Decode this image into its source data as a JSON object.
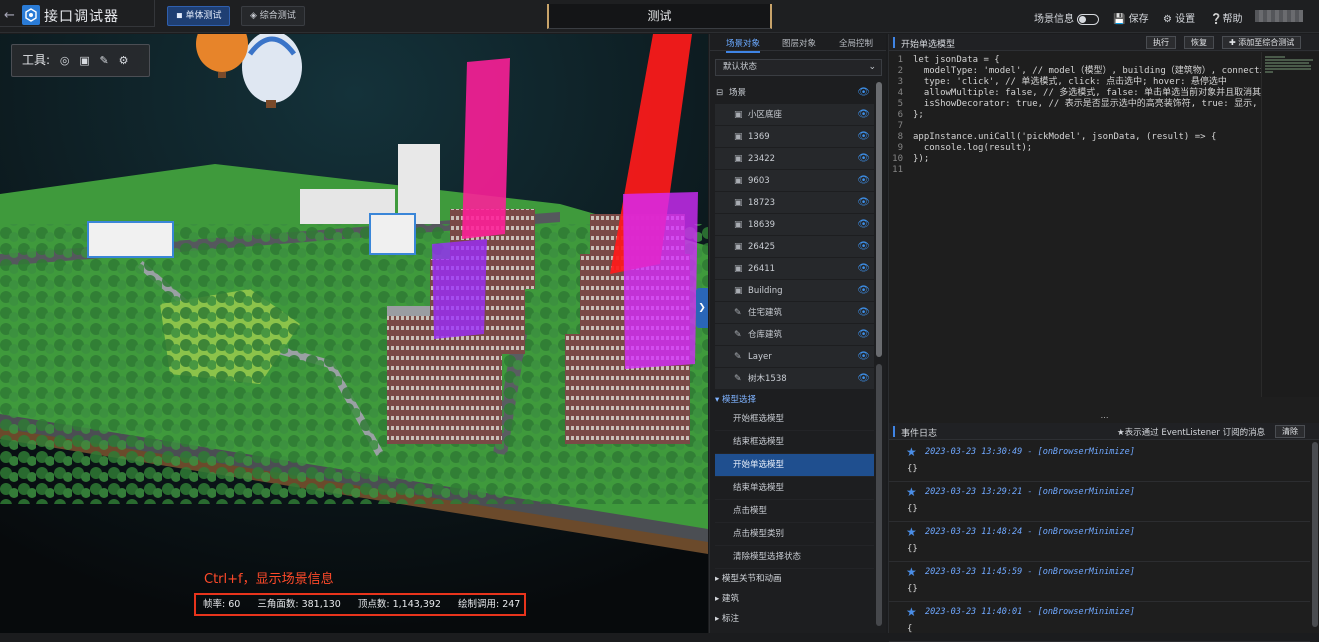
{
  "app": {
    "title": "接口调试器",
    "modes": [
      "单体测试",
      "综合测试"
    ],
    "center_tab": "测试",
    "scene_info_label": "场景信息",
    "save_label": "保存",
    "settings_label": "设置",
    "help_label": "帮助"
  },
  "scene": {
    "tools_label": "工具:",
    "hint": "Ctrl+f，显示场景信息",
    "stats": {
      "fps": "帧率: 60",
      "triangles": "三角面数: 381,130",
      "vertices": "顶点数: 1,143,392",
      "draw_calls": "绘制调用: 247"
    }
  },
  "middle": {
    "tabs": [
      "场景对象",
      "图层对象",
      "全局控制"
    ],
    "state_select": "默认状态",
    "tree_root": "场景",
    "tree_items": [
      "小区底座",
      "1369",
      "23422",
      "9603",
      "18723",
      "18639",
      "26425",
      "26411",
      "Building",
      "住宅建筑",
      "仓库建筑",
      "Layer",
      "树木1538"
    ],
    "section_open": "模型选择",
    "section_items": [
      "开始框选模型",
      "结束框选模型",
      "开始单选模型",
      "结束单选模型",
      "点击模型",
      "点击模型类别",
      "清除模型选择状态"
    ],
    "section_more": [
      "模型关节和动画",
      "建筑",
      "标注"
    ]
  },
  "editor": {
    "title": "开始单选模型",
    "run": "执行",
    "restore": "恢复",
    "add": "添加至综合测试",
    "line_numbers": [
      "1",
      "2",
      "3",
      "4",
      "5",
      "6",
      "7",
      "8",
      "9",
      "10",
      "11"
    ],
    "lines": [
      "let jsonData = {",
      "  modelType: 'model', // model（模型）, building（建筑物）, connection",
      "  type: 'click', // 单选模式, click: 点击选中; hover: 悬停选中",
      "  allowMultiple: false, // 多选模式, false: 单击单选当前对象并且取消其",
      "  isShowDecorator: true, // 表示是否显示选中的高亮装饰符, true: 显示,",
      "};",
      "",
      "appInstance.uniCall('pickModel', jsonData, (result) => {",
      "  console.log(result);",
      "});",
      ""
    ]
  },
  "events": {
    "title": "事件日志",
    "note": "★表示通过 EventListener 订阅的消息",
    "clear": "清除",
    "entries": [
      {
        "ts": "2023-03-23 13:30:49 - [onBrowserMinimize]",
        "obj": "{}"
      },
      {
        "ts": "2023-03-23 13:29:21 - [onBrowserMinimize]",
        "obj": "{}"
      },
      {
        "ts": "2023-03-23 11:48:24 - [onBrowserMinimize]",
        "obj": "{}"
      },
      {
        "ts": "2023-03-23 11:45:59 - [onBrowserMinimize]",
        "obj": "{}"
      },
      {
        "ts": "2023-03-23 11:40:01 - [onBrowserMinimize]",
        "obj": "{"
      }
    ]
  }
}
